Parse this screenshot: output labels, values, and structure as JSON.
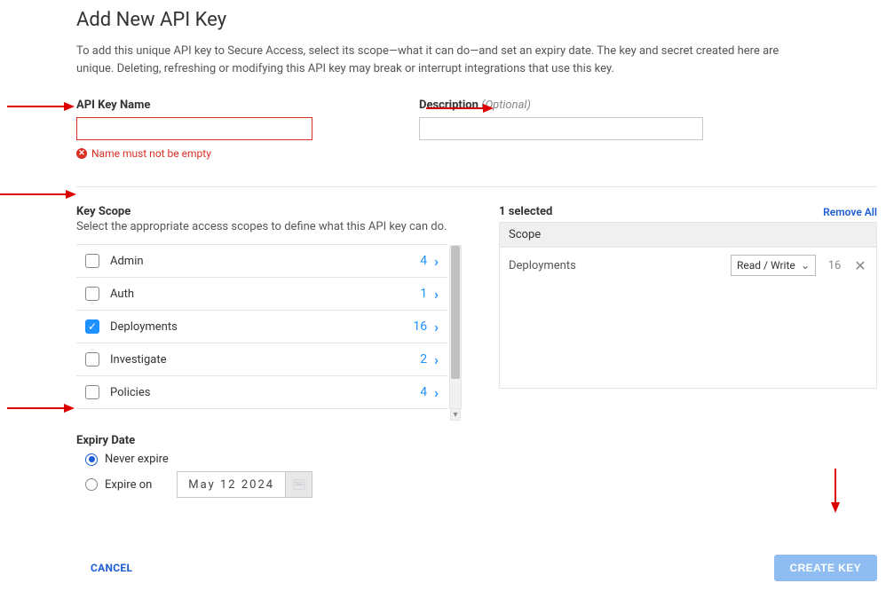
{
  "title": "Add New API Key",
  "intro": "To add this unique API key to Secure Access, select its scope—what it can do—and set an expiry date. The key and secret created here are unique. Deleting, refreshing or modifying this API key may break or interrupt integrations that use this key.",
  "fields": {
    "name_label": "API Key Name",
    "name_value": "",
    "name_error": "Name must not be empty",
    "desc_label": "Description",
    "desc_optional": "(Optional)",
    "desc_value": ""
  },
  "scope": {
    "heading": "Key Scope",
    "sub": "Select the appropriate access scopes to define what this API key can do.",
    "items": [
      {
        "label": "Admin",
        "count": 4,
        "checked": false
      },
      {
        "label": "Auth",
        "count": 1,
        "checked": false
      },
      {
        "label": "Deployments",
        "count": 16,
        "checked": true
      },
      {
        "label": "Investigate",
        "count": 2,
        "checked": false
      },
      {
        "label": "Policies",
        "count": 4,
        "checked": false
      }
    ]
  },
  "selected": {
    "count_label": "1 selected",
    "remove_all": "Remove All",
    "col_scope": "Scope",
    "rows": [
      {
        "name": "Deployments",
        "perm": "Read / Write",
        "count": 16
      }
    ]
  },
  "expiry": {
    "heading": "Expiry Date",
    "never_label": "Never expire",
    "on_label": "Expire on",
    "selected": "never",
    "date_text": "May  12   2024"
  },
  "footer": {
    "cancel": "CANCEL",
    "create": "CREATE KEY"
  }
}
